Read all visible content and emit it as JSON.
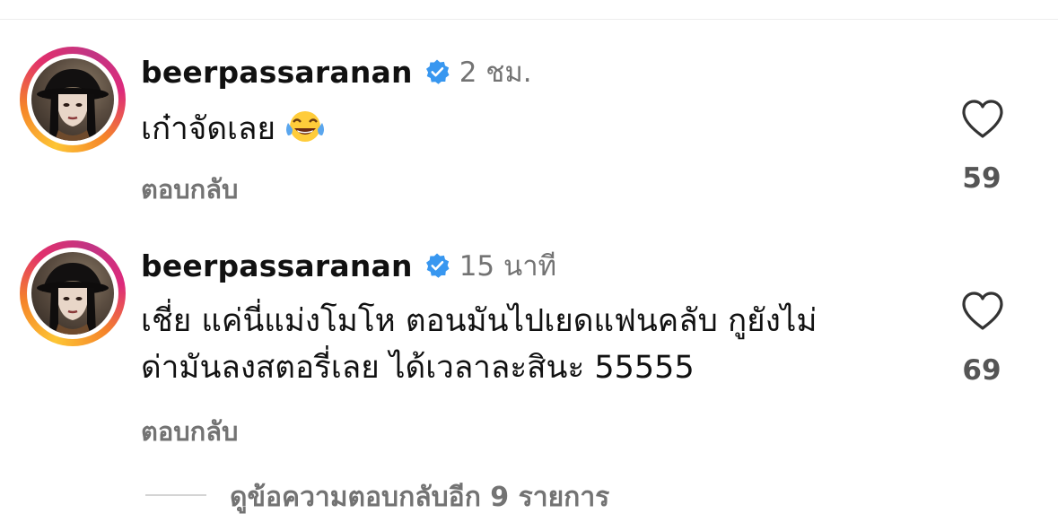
{
  "comments": [
    {
      "username": "beerpassaranan",
      "time": "2 ชม.",
      "text": "เก๋าจัดเลย",
      "emoji": "face-with-tears-of-joy",
      "reply_label": "ตอบกลับ",
      "likes": "59"
    },
    {
      "username": "beerpassaranan",
      "time": "15 นาที",
      "text_line1": "เชี่ย แค่นี่แม่งโมโห ตอนมันไปเยดแฟนคลับ กูยังไม่",
      "text_line2": "ด่ามันลงสตอรี่เลย ได้เวลาละสินะ 55555",
      "reply_label": "ตอบกลับ",
      "likes": "69"
    }
  ],
  "view_more_replies": "ดูข้อความตอบกลับอีก 9 รายการ",
  "colors": {
    "verified": "#3897f0",
    "secondary_text": "#737373",
    "ring_gradient": [
      "#fdc535",
      "#f58529",
      "#e1306c",
      "#c13584"
    ]
  }
}
